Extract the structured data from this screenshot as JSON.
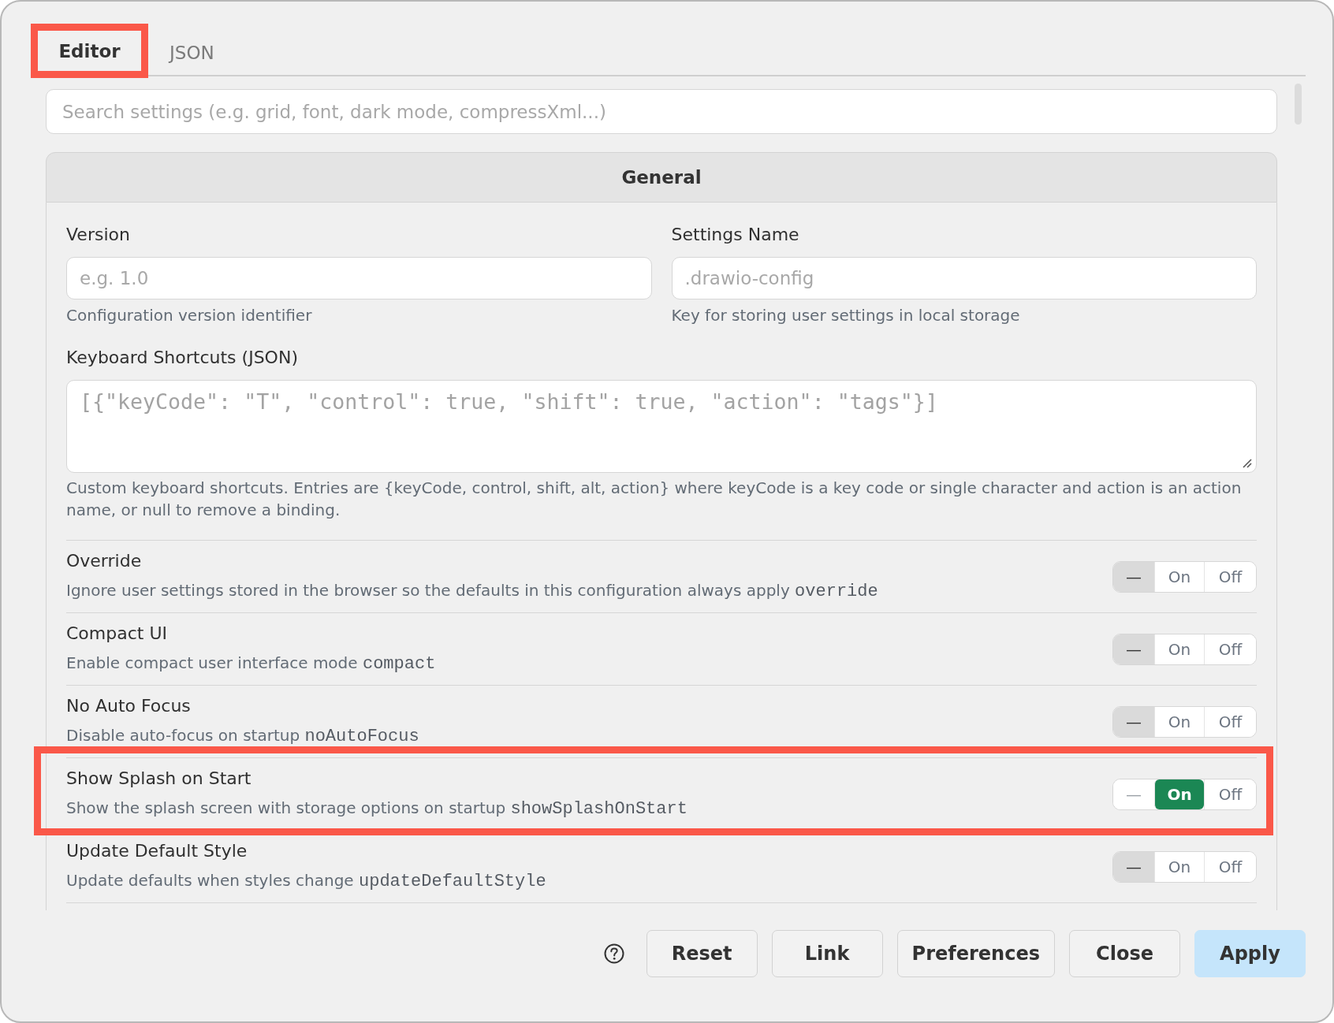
{
  "tabs": [
    {
      "label": "Editor",
      "selected": true,
      "highlighted": true
    },
    {
      "label": "JSON",
      "selected": false,
      "highlighted": false
    }
  ],
  "search": {
    "placeholder": "Search settings (e.g. grid, font, dark mode, compressXml...)"
  },
  "section": {
    "title": "General",
    "fields": [
      {
        "label": "Version",
        "placeholder": "e.g. 1.0",
        "help": "Configuration version identifier"
      },
      {
        "label": "Settings Name",
        "placeholder": ".drawio-config",
        "help": "Key for storing user settings in local storage"
      }
    ],
    "shortcuts": {
      "label": "Keyboard Shortcuts (JSON)",
      "placeholder": "[{\"keyCode\": \"T\", \"control\": true, \"shift\": true, \"action\": \"tags\"}]",
      "help": "Custom keyboard shortcuts. Entries are {keyCode, control, shift, alt, action} where keyCode is a key code or single character and action is an action name, or null to remove a binding."
    },
    "settings": [
      {
        "title": "Override",
        "description": "Ignore user settings stored in the browser so the defaults in this configuration always apply",
        "key": "override",
        "highlighted": false,
        "options": [
          {
            "label": "—",
            "kind": "unset",
            "selected": true
          },
          {
            "label": "On",
            "kind": "on",
            "selected": false
          },
          {
            "label": "Off",
            "kind": "off",
            "selected": false
          }
        ]
      },
      {
        "title": "Compact UI",
        "description": "Enable compact user interface mode",
        "key": "compact",
        "highlighted": false,
        "options": [
          {
            "label": "—",
            "kind": "unset",
            "selected": true
          },
          {
            "label": "On",
            "kind": "on",
            "selected": false
          },
          {
            "label": "Off",
            "kind": "off",
            "selected": false
          }
        ]
      },
      {
        "title": "No Auto Focus",
        "description": "Disable auto-focus on startup",
        "key": "noAutoFocus",
        "highlighted": false,
        "options": [
          {
            "label": "—",
            "kind": "unset",
            "selected": true
          },
          {
            "label": "On",
            "kind": "on",
            "selected": false
          },
          {
            "label": "Off",
            "kind": "off",
            "selected": false
          }
        ]
      },
      {
        "title": "Show Splash on Start",
        "description": "Show the splash screen with storage options on startup",
        "key": "showSplashOnStart",
        "highlighted": true,
        "options": [
          {
            "label": "—",
            "kind": "unset",
            "selected": false
          },
          {
            "label": "On",
            "kind": "on",
            "selected": true
          },
          {
            "label": "Off",
            "kind": "off",
            "selected": false
          }
        ]
      },
      {
        "title": "Update Default Style",
        "description": "Update defaults when styles change",
        "key": "updateDefaultStyle",
        "highlighted": false,
        "options": [
          {
            "label": "—",
            "kind": "unset",
            "selected": true
          },
          {
            "label": "On",
            "kind": "on",
            "selected": false
          },
          {
            "label": "Off",
            "kind": "off",
            "selected": false
          }
        ]
      }
    ]
  },
  "footer": {
    "buttons": [
      {
        "label": "Reset",
        "primary": false
      },
      {
        "label": "Link",
        "primary": false
      },
      {
        "label": "Preferences",
        "primary": false
      },
      {
        "label": "Close",
        "primary": false
      },
      {
        "label": "Apply",
        "primary": true
      }
    ]
  }
}
